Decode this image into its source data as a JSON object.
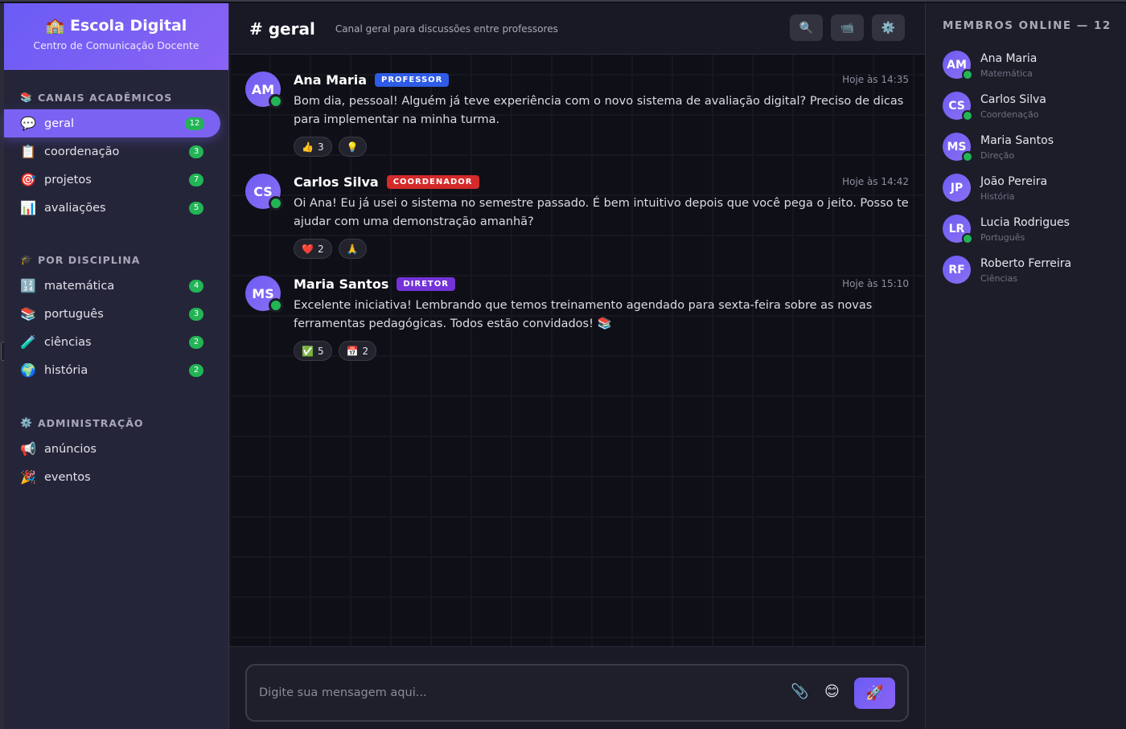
{
  "sidebar": {
    "brand_title": "🏫 Escola Digital",
    "brand_subtitle": "Centro de Comunicação Docente",
    "sections": [
      {
        "title": "CANAIS ACADÊMICOS",
        "icon": "📚",
        "channels": [
          {
            "icon": "💬",
            "label": "geral",
            "badge": "12",
            "active": true
          },
          {
            "icon": "📋",
            "label": "coordenação",
            "badge": "3"
          },
          {
            "icon": "🎯",
            "label": "projetos",
            "badge": "7"
          },
          {
            "icon": "📊",
            "label": "avaliações",
            "badge": "5"
          }
        ]
      },
      {
        "title": "POR DISCIPLINA",
        "icon": "🎓",
        "channels": [
          {
            "icon": "🔢",
            "label": "matemática",
            "badge": "4"
          },
          {
            "icon": "📚",
            "label": "português",
            "badge": "3"
          },
          {
            "icon": "🧪",
            "label": "ciências",
            "badge": "2"
          },
          {
            "icon": "🌍",
            "label": "história",
            "badge": "2"
          }
        ]
      },
      {
        "title": "ADMINISTRAÇÃO",
        "icon": "⚙️",
        "channels": [
          {
            "icon": "📢",
            "label": "anúncios"
          },
          {
            "icon": "🎉",
            "label": "eventos"
          }
        ]
      }
    ]
  },
  "header": {
    "channel_name": "# geral",
    "channel_description": "Canal geral para discussões entre professores",
    "actions": [
      {
        "icon": "🔍",
        "name": "search-icon"
      },
      {
        "icon": "📹",
        "name": "video-icon"
      },
      {
        "icon": "⚙️",
        "name": "settings-gear-icon"
      }
    ]
  },
  "messages": [
    {
      "initials": "AM",
      "author": "Ana Maria",
      "role": "PROFESSOR",
      "time": "Hoje às 14:35",
      "text": "Bom dia, pessoal! Alguém já teve experiência com o novo sistema de avaliação digital? Preciso de dicas para implementar na minha turma.",
      "reactions": [
        {
          "emoji": "👍",
          "count": "3"
        },
        {
          "emoji": "💡",
          "count": ""
        }
      ]
    },
    {
      "initials": "CS",
      "author": "Carlos Silva",
      "role": "COORDENADOR",
      "time": "Hoje às 14:42",
      "text": "Oi Ana! Eu já usei o sistema no semestre passado. É bem intuitivo depois que você pega o jeito. Posso te ajudar com uma demonstração amanhã?",
      "reactions": [
        {
          "emoji": "❤️",
          "count": "2"
        },
        {
          "emoji": "🙏",
          "count": ""
        }
      ]
    },
    {
      "initials": "MS",
      "author": "Maria Santos",
      "role": "DIRETOR",
      "time": "Hoje às 15:10",
      "text": "Excelente iniciativa! Lembrando que temos treinamento agendado para sexta-feira sobre as novas ferramentas pedagógicas. Todos estão convidados! 📚",
      "reactions": [
        {
          "emoji": "✅",
          "count": "5"
        },
        {
          "emoji": "📅",
          "count": "2"
        }
      ]
    }
  ],
  "composer": {
    "placeholder": "Digite sua mensagem aqui...",
    "attach_icon": "📎",
    "emoji_icon": "😊",
    "send_icon": "🚀"
  },
  "members": {
    "title": "MEMBROS ONLINE — 12",
    "list": [
      {
        "initials": "AM",
        "name": "Ana Maria",
        "subtitle": "Matemática",
        "online": true
      },
      {
        "initials": "CS",
        "name": "Carlos Silva",
        "subtitle": "Coordenação",
        "online": true
      },
      {
        "initials": "MS",
        "name": "Maria Santos",
        "subtitle": "Direção",
        "online": true
      },
      {
        "initials": "JP",
        "name": "João Pereira",
        "subtitle": "História",
        "online": false
      },
      {
        "initials": "LR",
        "name": "Lucia Rodrigues",
        "subtitle": "Português",
        "online": true
      },
      {
        "initials": "RF",
        "name": "Roberto Ferreira",
        "subtitle": "Ciências",
        "online": false
      }
    ]
  }
}
